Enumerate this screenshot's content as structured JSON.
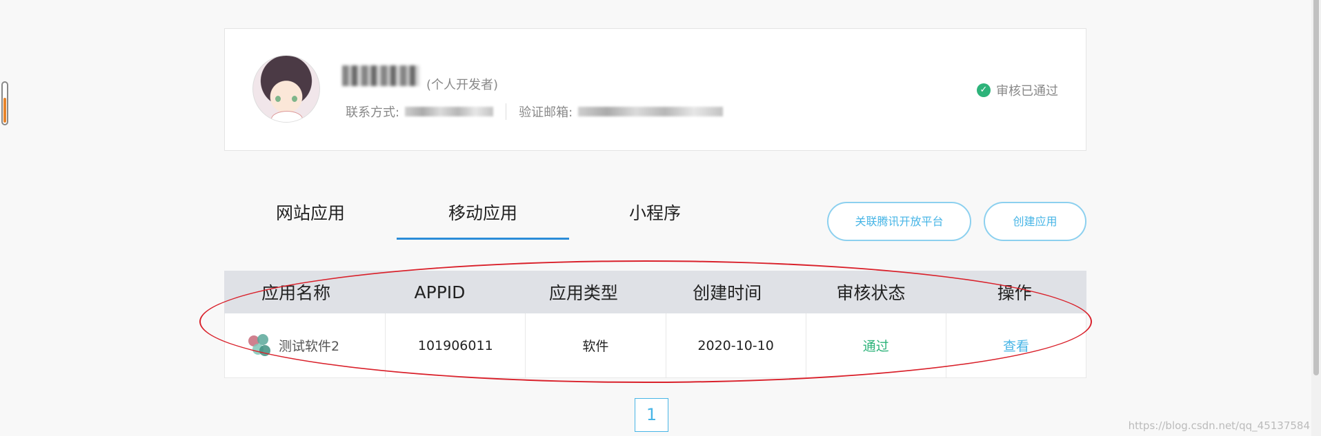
{
  "profile": {
    "developer_type": "(个人开发者)",
    "contact_label": "联系方式:",
    "email_label": "验证邮箱:",
    "review_status": "审核已通过"
  },
  "tabs": [
    {
      "label": "网站应用"
    },
    {
      "label": "移动应用"
    },
    {
      "label": "小程序"
    }
  ],
  "buttons": {
    "link_tencent": "关联腾讯开放平台",
    "create_app": "创建应用"
  },
  "table": {
    "headers": [
      "应用名称",
      "APPID",
      "应用类型",
      "创建时间",
      "审核状态",
      "操作"
    ],
    "rows": [
      {
        "name": "测试软件2",
        "appid": "101906011",
        "type": "软件",
        "created": "2020-10-10",
        "status": "通过",
        "action": "查看"
      }
    ]
  },
  "pagination": {
    "current": "1"
  },
  "watermark": "https://blog.csdn.net/qq_45137584",
  "colors": {
    "accent": "#47b5e6",
    "tab_underline": "#2b8cd8",
    "pass": "#2db37a",
    "annotation": "#d9202a"
  }
}
